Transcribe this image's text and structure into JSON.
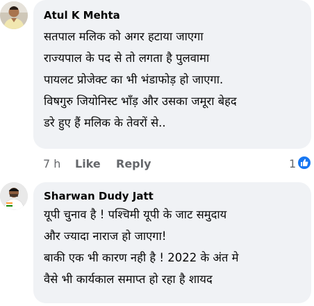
{
  "comments": [
    {
      "author": "Atul K Mehta",
      "lines": [
        "सतपाल मलिक को अगर हटाया जाएगा",
        "राज्यपाल के पद से तो लगता है पुलवामा",
        "पायलट प्रोजेक्ट का भी भंडाफोड़ हो जाएगा.",
        "विषगुरु जियोनिस्ट भाँड़ और उसका जमूरा बेहद",
        "डरे हुए हैं मलिक के तेवरों से.."
      ],
      "time": "7 h",
      "like_label": "Like",
      "reply_label": "Reply",
      "reaction_count": "1",
      "reaction_icon": "thumbs-up-icon",
      "reaction_color": "#1877f2"
    },
    {
      "author": "Sharwan Dudy Jatt",
      "lines": [
        "यूपी चुनाव है ! पश्चिमी यूपी के जाट समुदाय",
        "और ज्यादा नाराज हो जाएगा!",
        "बाकी एक भी कारण नही है  !  2022 के अंत मे",
        "वैसे भी कार्यकाल समाप्त हो रहा है शायद"
      ]
    }
  ],
  "colors": {
    "bubble": "#f0f2f5",
    "text": "#050505",
    "meta": "#65676b"
  }
}
